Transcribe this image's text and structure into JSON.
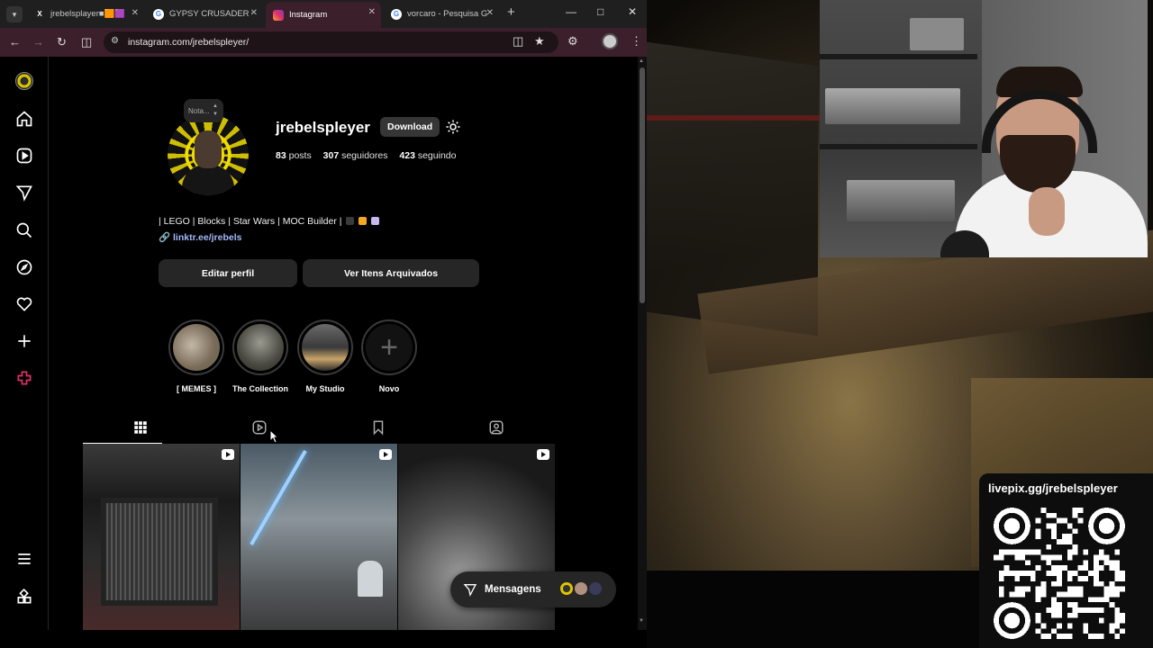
{
  "browser": {
    "tabs": [
      {
        "title": "jrebelsplayer■🟧🟪",
        "favicon": "X",
        "active": false
      },
      {
        "title": "GYPSY CRUSADER C",
        "favicon": "G",
        "active": false
      },
      {
        "title": "Instagram",
        "favicon": "ig",
        "active": true
      },
      {
        "title": "vorcaro - Pesquisa G",
        "favicon": "G",
        "active": false
      }
    ],
    "url": "instagram.com/jrebelspleyer/"
  },
  "sidebar": {
    "icons": [
      "profile-avatar",
      "home-icon",
      "reels-icon",
      "messages-icon",
      "search-icon",
      "explore-icon",
      "notifications-icon",
      "create-icon",
      "meta-ai-icon",
      "menu-icon",
      "also-from-meta-icon"
    ]
  },
  "profile": {
    "note": "Nota...",
    "username": "jrebelspleyer",
    "download_label": "Download",
    "posts_count": "83",
    "posts_label": "posts",
    "followers_count": "307",
    "followers_label": "seguidores",
    "following_count": "423",
    "following_label": "seguindo",
    "bio": "| LEGO | Blocks | Star Wars | MOC Builder |",
    "bio_link": "linktr.ee/jrebels",
    "edit_label": "Editar perfil",
    "archive_label": "Ver Itens Arquivados"
  },
  "highlights": [
    {
      "label": "[ MEMES ]"
    },
    {
      "label": "The Collection"
    },
    {
      "label": "My Studio"
    },
    {
      "label": "Novo"
    }
  ],
  "messages": {
    "label": "Mensagens"
  },
  "stream": {
    "qr_title": "livepix.gg/jrebelspleyer"
  },
  "colors": {
    "accent_link": "#a4b8f7",
    "tab_active": "#3b1f2b",
    "ai_icon": "#e1306c"
  }
}
